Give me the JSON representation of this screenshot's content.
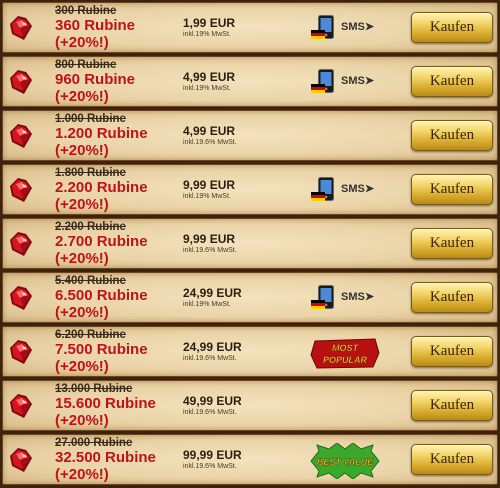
{
  "offers": [
    {
      "old": "300 Rubine",
      "new": "360 Rubine",
      "bonus": "(+20%!)",
      "price": "1,99 EUR",
      "tax": "inkl.19% MwSt.",
      "extra": "sms",
      "button": "Kaufen"
    },
    {
      "old": "800 Rubine",
      "new": "960 Rubine",
      "bonus": "(+20%!)",
      "price": "4,99 EUR",
      "tax": "inkl.19% MwSt.",
      "extra": "sms",
      "button": "Kaufen"
    },
    {
      "old": "1.000 Rubine",
      "new": "1.200 Rubine",
      "bonus": "(+20%!)",
      "price": "4,99 EUR",
      "tax": "inkl.19.6% MwSt.",
      "extra": "none",
      "button": "Kaufen"
    },
    {
      "old": "1.800 Rubine",
      "new": "2.200 Rubine",
      "bonus": "(+20%!)",
      "price": "9,99 EUR",
      "tax": "inkl.19% MwSt.",
      "extra": "sms",
      "button": "Kaufen"
    },
    {
      "old": "2.200 Rubine",
      "new": "2.700 Rubine",
      "bonus": "(+20%!)",
      "price": "9,99 EUR",
      "tax": "inkl.19.6% MwSt.",
      "extra": "none",
      "button": "Kaufen"
    },
    {
      "old": "5.400 Rubine",
      "new": "6.500 Rubine",
      "bonus": "(+20%!)",
      "price": "24,99 EUR",
      "tax": "inkl.19% MwSt.",
      "extra": "sms",
      "button": "Kaufen"
    },
    {
      "old": "6.200 Rubine",
      "new": "7.500 Rubine",
      "bonus": "(+20%!)",
      "price": "24,99 EUR",
      "tax": "inkl.19.6% MwSt.",
      "extra": "most-popular",
      "button": "Kaufen"
    },
    {
      "old": "13.000 Rubine",
      "new": "15.600 Rubine",
      "bonus": "(+20%!)",
      "price": "49,99 EUR",
      "tax": "inkl.19.6% MwSt.",
      "extra": "none",
      "button": "Kaufen"
    },
    {
      "old": "27.000 Rubine",
      "new": "32.500 Rubine",
      "bonus": "(+20%!)",
      "price": "99,99 EUR",
      "tax": "inkl.19.6% MwSt.",
      "extra": "best-value",
      "button": "Kaufen"
    }
  ],
  "sms_label": "SMS➤",
  "most_popular": [
    "MOST",
    "POPULAR"
  ],
  "best_value": "BEST VALUE",
  "colors": {
    "ruby": "#c8101a",
    "price_new": "#c0121a",
    "button": "#e8c04a",
    "parchment": "#ead4a8"
  },
  "icons": {
    "ruby": "ruby-gem-icon",
    "sms": "mobile-phone-icon",
    "flag": "german-flag-icon"
  }
}
